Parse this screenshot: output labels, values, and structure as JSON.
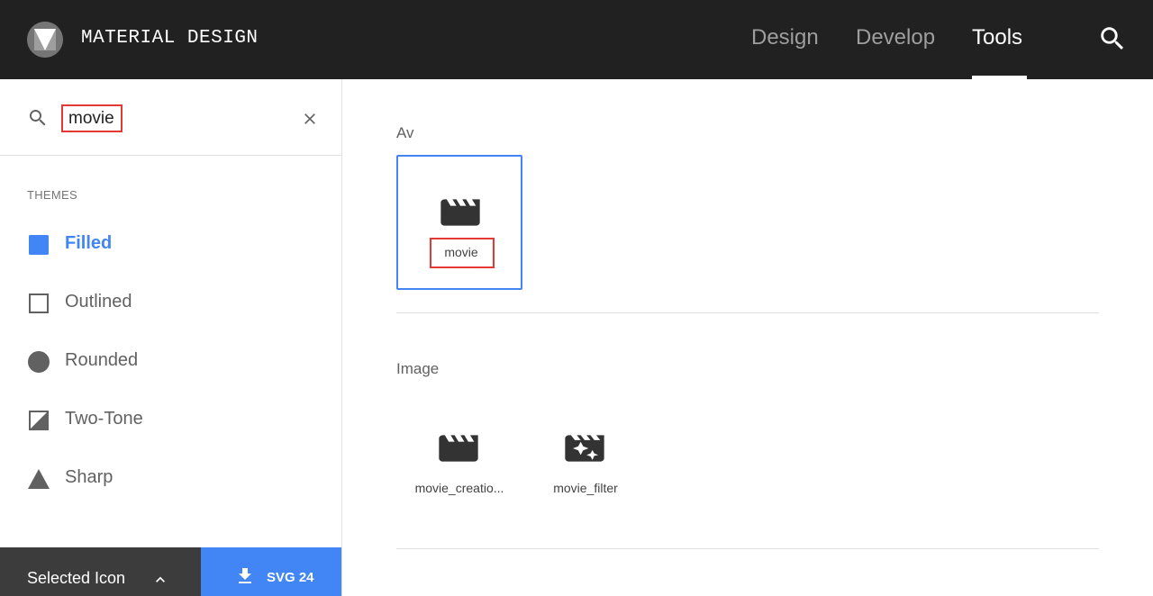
{
  "header": {
    "brand": "MATERIAL DESIGN",
    "nav": [
      "Design",
      "Develop",
      "Tools"
    ],
    "active_nav": "Tools"
  },
  "search": {
    "value": "movie",
    "placeholder": ""
  },
  "themes": {
    "heading": "THEMES",
    "items": [
      {
        "label": "Filled",
        "icon": "filled-square-icon",
        "active": true
      },
      {
        "label": "Outlined",
        "icon": "outlined-square-icon",
        "active": false
      },
      {
        "label": "Rounded",
        "icon": "circle-icon",
        "active": false
      },
      {
        "label": "Two-Tone",
        "icon": "two-tone-square-icon",
        "active": false
      },
      {
        "label": "Sharp",
        "icon": "triangle-icon",
        "active": false
      }
    ]
  },
  "bottom": {
    "selected_label": "Selected Icon",
    "download_label": "SVG 24"
  },
  "sections": [
    {
      "title": "Av",
      "icons": [
        {
          "name": "movie",
          "icon": "movie-icon",
          "selected": true
        }
      ]
    },
    {
      "title": "Image",
      "icons": [
        {
          "name": "movie_creatio...",
          "icon": "movie-creation-icon",
          "selected": false
        },
        {
          "name": "movie_filter",
          "icon": "movie-filter-icon",
          "selected": false
        }
      ]
    }
  ],
  "colors": {
    "header_bg": "#212121",
    "accent": "#4285f4",
    "highlight": "#e53935",
    "bottom_dark": "#3c3c3c"
  }
}
